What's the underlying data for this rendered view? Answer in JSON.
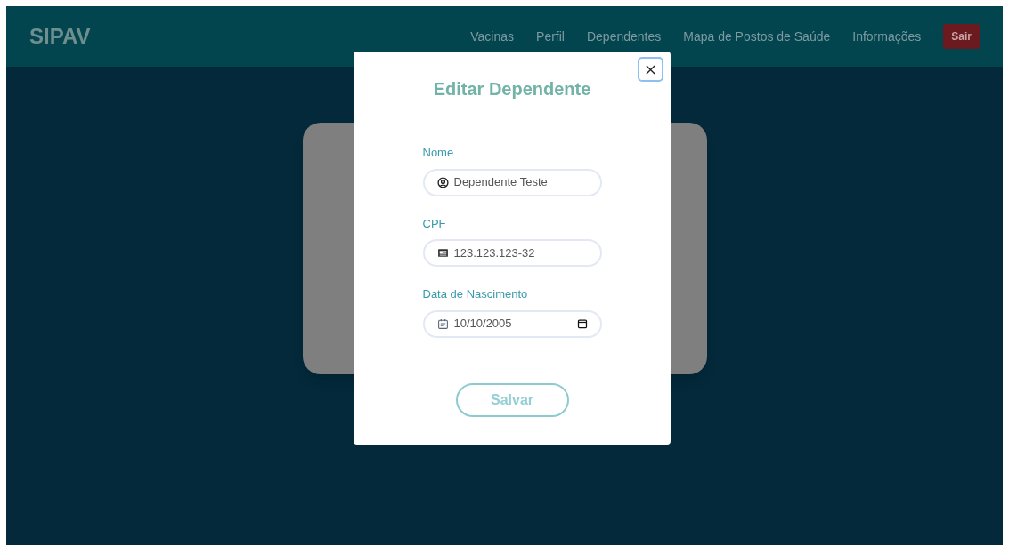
{
  "navbar": {
    "brand": "SIPAV",
    "links": [
      "Vacinas",
      "Perfil",
      "Dependentes",
      "Mapa de Postos de Saúde",
      "Informações"
    ],
    "logout": "Sair"
  },
  "modal": {
    "title": "Editar Dependente",
    "fields": [
      {
        "label": "Nome",
        "kind": "person",
        "value": "Dependente Teste"
      },
      {
        "label": "CPF",
        "kind": "card",
        "value": "123.123.123-32"
      },
      {
        "label": "Data de Nascimento",
        "kind": "date",
        "value": "10/10/2005"
      }
    ],
    "save": "Salvar"
  }
}
